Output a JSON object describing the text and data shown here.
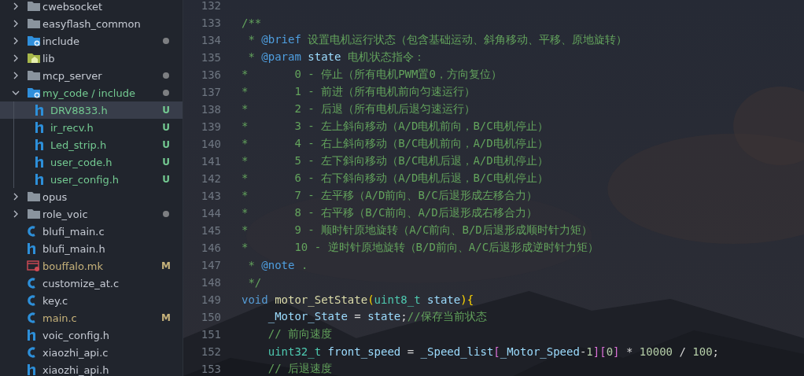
{
  "explorer": {
    "items": [
      {
        "name": "cwebsocket",
        "kind": "folder",
        "expanded": false
      },
      {
        "name": "easyflash_common",
        "kind": "folder",
        "expanded": false
      },
      {
        "name": "include",
        "kind": "include-folder",
        "expanded": false,
        "changes_inside": true
      },
      {
        "name": "lib",
        "kind": "lib-folder",
        "expanded": false
      },
      {
        "name": "mcp_server",
        "kind": "folder",
        "expanded": false,
        "changes_inside": true
      },
      {
        "name": "my_code / include",
        "kind": "include-folder",
        "expanded": true,
        "changes_inside": true,
        "untracked": true,
        "children": [
          {
            "name": "DRV8833.h",
            "kind": "header-file",
            "selected": true,
            "untracked": true,
            "badge": "U"
          },
          {
            "name": "ir_recv.h",
            "kind": "header-file",
            "selected": false,
            "untracked": true,
            "badge": "U"
          },
          {
            "name": "Led_strip.h",
            "kind": "header-file",
            "selected": false,
            "untracked": true,
            "badge": "U"
          },
          {
            "name": "user_code.h",
            "kind": "header-file",
            "selected": false,
            "untracked": true,
            "badge": "U"
          },
          {
            "name": "user_config.h",
            "kind": "header-file",
            "selected": false,
            "untracked": true,
            "badge": "U"
          }
        ]
      },
      {
        "name": "opus",
        "kind": "folder",
        "expanded": false
      },
      {
        "name": "role_voic",
        "kind": "folder",
        "expanded": false,
        "changes_inside": true
      },
      {
        "name": "blufi_main.c",
        "kind": "c-file",
        "selected": false
      },
      {
        "name": "blufi_main.h",
        "kind": "header-file",
        "selected": false
      },
      {
        "name": "bouffalo.mk",
        "kind": "make-file",
        "selected": false,
        "modified": true,
        "badge": "M"
      },
      {
        "name": "customize_at.c",
        "kind": "c-file",
        "selected": false
      },
      {
        "name": "key.c",
        "kind": "c-file",
        "selected": false
      },
      {
        "name": "main.c",
        "kind": "c-file",
        "selected": false,
        "modified": true,
        "badge": "M"
      },
      {
        "name": "voic_config.h",
        "kind": "header-file",
        "selected": false
      },
      {
        "name": "xiaozhi_api.c",
        "kind": "c-file",
        "selected": false
      },
      {
        "name": "xiaozhi_api.h",
        "kind": "header-file",
        "selected": false
      }
    ]
  },
  "editor": {
    "lines": [
      {
        "number": "132"
      },
      {
        "number": "133",
        "tokens": [
          {
            "text": "/**",
            "kind": "comment"
          }
        ]
      },
      {
        "number": "134",
        "tokens": [
          {
            "text": " * ",
            "kind": "comment"
          },
          {
            "text": "@brief",
            "kind": "doc-tag"
          },
          {
            "text": " 设置电机运行状态（包含基础运动、斜角移动、平移、原地旋转）",
            "kind": "comment"
          }
        ]
      },
      {
        "number": "135",
        "tokens": [
          {
            "text": " * ",
            "kind": "comment"
          },
          {
            "text": "@param",
            "kind": "doc-tag"
          },
          {
            "text": " state",
            "kind": "param"
          },
          {
            "text": " 电机状态指令：",
            "kind": "comment"
          }
        ]
      },
      {
        "number": "136",
        "tokens": [
          {
            "text": "*       0 - 停止（所有电机PWM置0，方向复位）",
            "kind": "comment"
          }
        ]
      },
      {
        "number": "137",
        "tokens": [
          {
            "text": "*       1 - 前进（所有电机前向匀速运行）",
            "kind": "comment"
          }
        ]
      },
      {
        "number": "138",
        "tokens": [
          {
            "text": "*       2 - 后退（所有电机后退匀速运行）",
            "kind": "comment"
          }
        ]
      },
      {
        "number": "139",
        "tokens": [
          {
            "text": "*       3 - 左上斜向移动（A/D电机前向，B/C电机停止）",
            "kind": "comment"
          }
        ]
      },
      {
        "number": "140",
        "tokens": [
          {
            "text": "*       4 - 右上斜向移动（B/C电机前向，A/D电机停止）",
            "kind": "comment"
          }
        ]
      },
      {
        "number": "141",
        "tokens": [
          {
            "text": "*       5 - 左下斜向移动（B/C电机后退，A/D电机停止）",
            "kind": "comment"
          }
        ]
      },
      {
        "number": "142",
        "tokens": [
          {
            "text": "*       6 - 右下斜向移动（A/D电机后退，B/C电机停止）",
            "kind": "comment"
          }
        ]
      },
      {
        "number": "143",
        "tokens": [
          {
            "text": "*       7 - 左平移（A/D前向、B/C后退形成左移合力）",
            "kind": "comment"
          }
        ]
      },
      {
        "number": "144",
        "tokens": [
          {
            "text": "*       8 - 右平移（B/C前向、A/D后退形成右移合力）",
            "kind": "comment"
          }
        ]
      },
      {
        "number": "145",
        "tokens": [
          {
            "text": "*       9 - 顺时针原地旋转（A/C前向、B/D后退形成顺时针力矩）",
            "kind": "comment"
          }
        ]
      },
      {
        "number": "146",
        "tokens": [
          {
            "text": "*       10 - 逆时针原地旋转（B/D前向、A/C后退形成逆时针力矩）",
            "kind": "comment"
          }
        ]
      },
      {
        "number": "147",
        "tokens": [
          {
            "text": " * ",
            "kind": "comment"
          },
          {
            "text": "@note",
            "kind": "doc-tag"
          },
          {
            "text": " .",
            "kind": "comment"
          }
        ]
      },
      {
        "number": "148",
        "tokens": [
          {
            "text": " */",
            "kind": "comment"
          }
        ]
      },
      {
        "number": "149",
        "tokens": [
          {
            "text": "void",
            "kind": "keyword"
          },
          {
            "text": " motor_SetState",
            "kind": "function"
          },
          {
            "text": "(",
            "kind": "bracket"
          },
          {
            "text": "uint8_t",
            "kind": "type"
          },
          {
            "text": " state",
            "kind": "variable"
          },
          {
            "text": ")",
            "kind": "bracket"
          },
          {
            "text": "{",
            "kind": "bracket"
          }
        ]
      },
      {
        "number": "150",
        "tokens": [
          {
            "text": "    _Motor_State",
            "kind": "variable"
          },
          {
            "text": " = ",
            "kind": "plain"
          },
          {
            "text": "state",
            "kind": "variable"
          },
          {
            "text": ";",
            "kind": "plain"
          },
          {
            "text": "//保存当前状态",
            "kind": "comment"
          }
        ]
      },
      {
        "number": "151",
        "tokens": [
          {
            "text": "    // 前向速度",
            "kind": "comment"
          }
        ]
      },
      {
        "number": "152",
        "tokens": [
          {
            "text": "    uint32_t",
            "kind": "type"
          },
          {
            "text": " front_speed",
            "kind": "variable"
          },
          {
            "text": " = ",
            "kind": "plain"
          },
          {
            "text": "_Speed_list",
            "kind": "variable"
          },
          {
            "text": "[",
            "kind": "bracket2"
          },
          {
            "text": "_Motor_Speed",
            "kind": "variable"
          },
          {
            "text": "-",
            "kind": "plain"
          },
          {
            "text": "1",
            "kind": "number"
          },
          {
            "text": "]",
            "kind": "bracket2"
          },
          {
            "text": "[",
            "kind": "bracket2"
          },
          {
            "text": "0",
            "kind": "number"
          },
          {
            "text": "]",
            "kind": "bracket2"
          },
          {
            "text": " * ",
            "kind": "plain"
          },
          {
            "text": "10000",
            "kind": "number"
          },
          {
            "text": " / ",
            "kind": "plain"
          },
          {
            "text": "100",
            "kind": "number"
          },
          {
            "text": ";",
            "kind": "plain"
          }
        ]
      },
      {
        "number": "153",
        "tokens": [
          {
            "text": "    // 后退速度",
            "kind": "comment"
          }
        ]
      }
    ]
  }
}
